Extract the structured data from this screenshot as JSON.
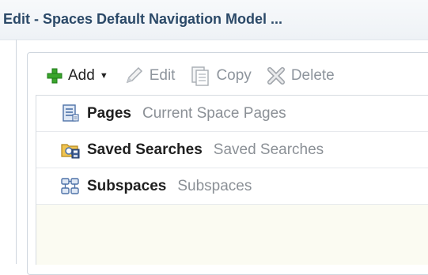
{
  "window": {
    "title": "Edit - Spaces Default Navigation Model ..."
  },
  "toolbar": {
    "add_label": "Add",
    "edit_label": "Edit",
    "copy_label": "Copy",
    "delete_label": "Delete",
    "add_color": "#3aa52c"
  },
  "items": [
    {
      "name": "Pages",
      "description": "Current Space Pages",
      "icon": "pages-icon"
    },
    {
      "name": "Saved Searches",
      "description": "Saved Searches",
      "icon": "saved-searches-icon"
    },
    {
      "name": "Subspaces",
      "description": "Subspaces",
      "icon": "subspaces-icon"
    }
  ]
}
